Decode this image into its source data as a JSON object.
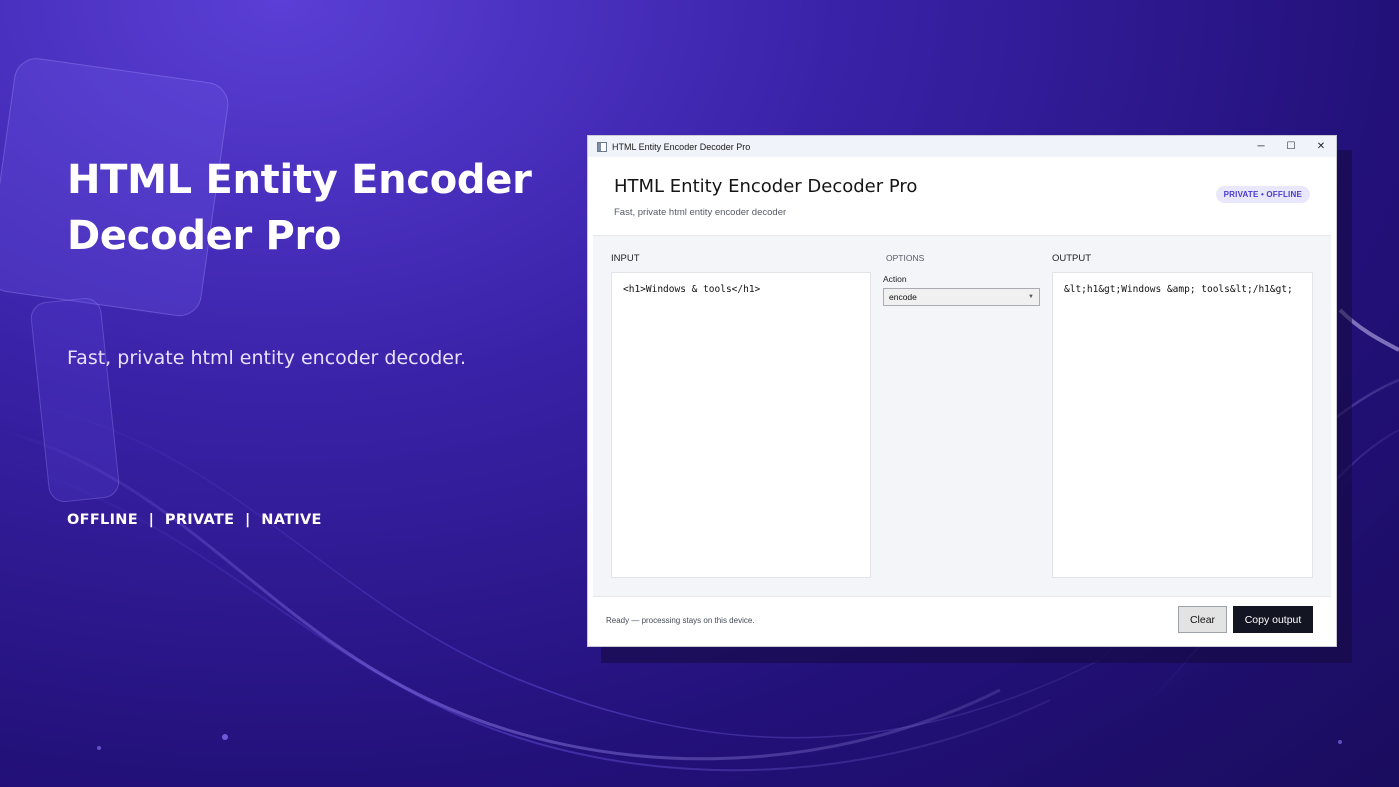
{
  "hero": {
    "title": "HTML Entity Encoder Decoder Pro",
    "subtitle": "Fast, private html entity encoder decoder.",
    "tags": "OFFLINE  |  PRIVATE  |  NATIVE"
  },
  "window": {
    "titlebar_text": "HTML Entity Encoder Decoder Pro",
    "controls": {
      "minimize": "─",
      "maximize": "☐",
      "close": "✕"
    }
  },
  "header": {
    "title": "HTML Entity Encoder Decoder Pro",
    "subtitle": "Fast, private html entity encoder decoder",
    "badge": "PRIVATE • OFFLINE"
  },
  "input": {
    "label": "INPUT",
    "value": "<h1>Windows & tools</h1>"
  },
  "options": {
    "label": "OPTIONS",
    "action_label": "Action",
    "action_value": "encode"
  },
  "output": {
    "label": "OUTPUT",
    "value": "&lt;h1&gt;Windows &amp; tools&lt;/h1&gt;"
  },
  "footer": {
    "status": "Ready — processing stays on this device.",
    "clear_label": "Clear",
    "copy_label": "Copy output"
  },
  "colors": {
    "accent": "#4a3ccf",
    "badge_bg": "#e9e7fb",
    "primary_button": "#141522",
    "background_dark": "#23117a"
  }
}
